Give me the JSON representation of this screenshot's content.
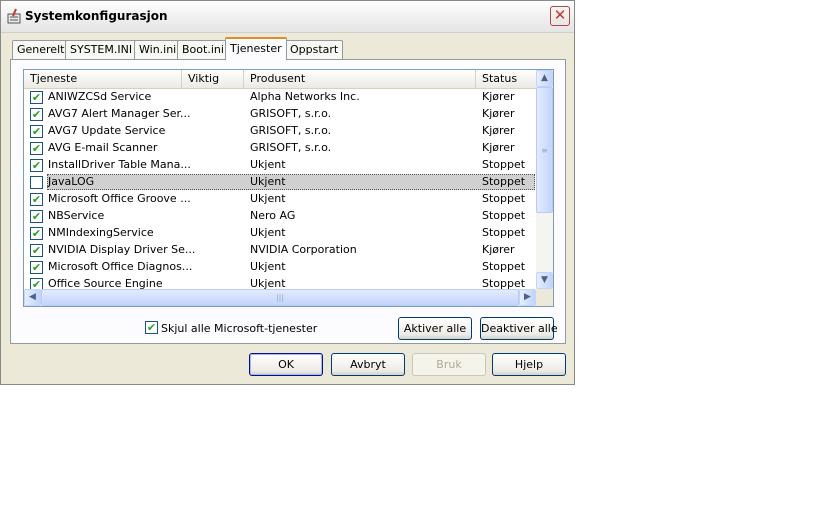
{
  "window": {
    "title": "Systemkonfigurasjon"
  },
  "tabs": [
    "Generelt",
    "SYSTEM.INI",
    "Win.ini",
    "Boot.ini",
    "Tjenester",
    "Oppstart"
  ],
  "active_tab": "Tjenester",
  "columns": [
    "Tjeneste",
    "Viktig",
    "Produsent",
    "Status"
  ],
  "services": [
    {
      "name": "ANIWZCSd Service",
      "vendor": "Alpha Networks Inc.",
      "status": "Kjører",
      "checked": true
    },
    {
      "name": "AVG7 Alert Manager Ser...",
      "vendor": "GRISOFT, s.r.o.",
      "status": "Kjører",
      "checked": true
    },
    {
      "name": "AVG7 Update Service",
      "vendor": "GRISOFT, s.r.o.",
      "status": "Kjører",
      "checked": true
    },
    {
      "name": "AVG E-mail Scanner",
      "vendor": "GRISOFT, s.r.o.",
      "status": "Kjører",
      "checked": true
    },
    {
      "name": "InstallDriver Table Mana...",
      "vendor": "Ukjent",
      "status": "Stoppet",
      "checked": true
    },
    {
      "name": "JavaLOG",
      "vendor": "Ukjent",
      "status": "Stoppet",
      "checked": false,
      "selected": true
    },
    {
      "name": "Microsoft Office Groove ...",
      "vendor": "Ukjent",
      "status": "Stoppet",
      "checked": true
    },
    {
      "name": "NBService",
      "vendor": "Nero AG",
      "status": "Stoppet",
      "checked": true
    },
    {
      "name": "NMIndexingService",
      "vendor": "Ukjent",
      "status": "Stoppet",
      "checked": true
    },
    {
      "name": "NVIDIA Display Driver Se...",
      "vendor": "NVIDIA Corporation",
      "status": "Kjører",
      "checked": true
    },
    {
      "name": "Microsoft Office Diagnos...",
      "vendor": "Ukjent",
      "status": "Stoppet",
      "checked": true
    },
    {
      "name": "Office Source Engine",
      "vendor": "Ukjent",
      "status": "Stoppet",
      "checked": true
    }
  ],
  "hide_ms": {
    "label": "Skjul alle Microsoft-tjenester",
    "checked": true
  },
  "buttons": {
    "enable_all": "Aktiver alle",
    "disable_all": "Deaktiver alle",
    "ok": "OK",
    "cancel": "Avbryt",
    "apply": "Bruk",
    "help": "Hjelp"
  },
  "icons": {
    "close": "close-icon",
    "app": "msconfig-icon",
    "scroll_up": "arrow-up-icon",
    "scroll_down": "arrow-down-icon",
    "scroll_left": "arrow-left-icon",
    "scroll_right": "arrow-right-icon",
    "check": "checkmark-icon"
  },
  "colors": {
    "check": "#21a121",
    "active_tab_accent": "#e68b2c",
    "selected_row": "#d0d0d0"
  }
}
